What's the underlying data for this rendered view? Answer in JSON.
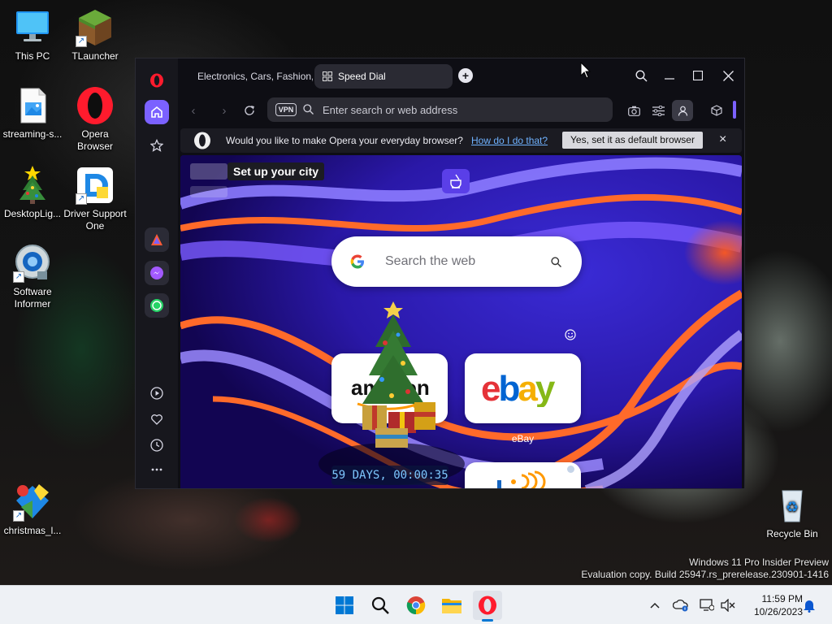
{
  "desktop": {
    "icons": [
      {
        "label": "This PC"
      },
      {
        "label": "TLauncher"
      },
      {
        "label": "streaming-s..."
      },
      {
        "label": "Opera Browser"
      },
      {
        "label": "DesktopLig..."
      },
      {
        "label": "Driver Support One"
      },
      {
        "label": "Software Informer"
      },
      {
        "label": "christmas_l..."
      },
      {
        "label": "Recycle Bin"
      }
    ],
    "watermark_line1": "Windows 11 Pro Insider Preview",
    "watermark_line2": "Evaluation copy. Build 25947.rs_prerelease.230901-1416"
  },
  "browser": {
    "tabs": [
      {
        "label": "Electronics, Cars, Fashion,",
        "active": false
      },
      {
        "label": "Speed Dial",
        "active": true
      }
    ],
    "new_tab_icon": "plus-icon",
    "address_bar": {
      "vpn_label": "VPN",
      "placeholder": "Enter search or web address"
    },
    "default_prompt": {
      "message": "Would you like to make Opera your everyday browser?",
      "link": "How do I do that?",
      "button": "Yes, set it as default browser",
      "close": "×"
    },
    "speed_dial": {
      "city_prompt": "Set up your city",
      "search_placeholder": "Search the web",
      "tiles": [
        {
          "name": "amazon",
          "label": ""
        },
        {
          "name": "ebay",
          "label": "eBay"
        },
        {
          "name": "booking",
          "label": ""
        }
      ],
      "countdown": "59 DAYS, 00:00:35"
    },
    "colors": {
      "accent": "#7b61ff",
      "opera_red": "#ff1b2d"
    }
  },
  "taskbar": {
    "time": "11:59 PM",
    "date": "10/26/2023"
  }
}
